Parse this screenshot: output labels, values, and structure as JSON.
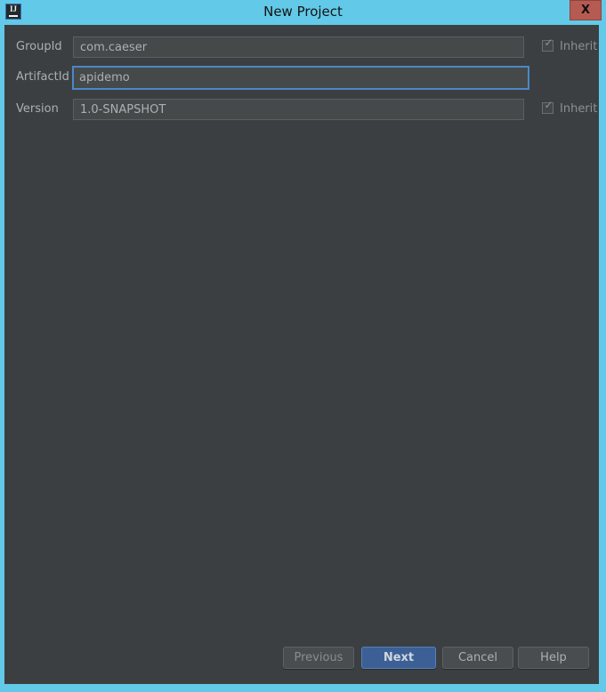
{
  "window": {
    "title": "New Project",
    "app_icon_text": "IJ",
    "close_label": "X",
    "accent_border_color": "#62c9e8",
    "dialog_bg_color": "#3c3f41",
    "close_button_color": "#b65b52",
    "focus_border_color": "#4a88c7",
    "default_button_color": "#3c6096"
  },
  "form": {
    "fields": [
      {
        "label": "GroupId",
        "value": "com.caeser",
        "placeholder": "",
        "focused": false,
        "inherit": {
          "label": "Inherit",
          "checked": true,
          "enabled": false
        }
      },
      {
        "label": "ArtifactId",
        "value": "apidemo",
        "placeholder": "",
        "focused": true,
        "inherit": null
      },
      {
        "label": "Version",
        "value": "1.0-SNAPSHOT",
        "placeholder": "",
        "focused": false,
        "inherit": {
          "label": "Inherit",
          "checked": true,
          "enabled": false
        }
      }
    ],
    "check_glyph": "✓"
  },
  "footer": {
    "previous_label": "Previous",
    "next_label": "Next",
    "cancel_label": "Cancel",
    "help_label": "Help"
  }
}
